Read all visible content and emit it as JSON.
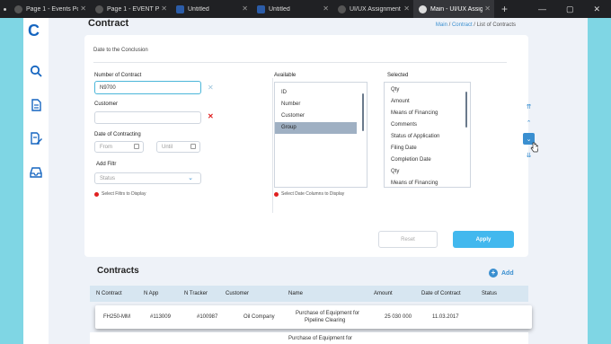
{
  "browser": {
    "tabs": [
      {
        "title": "Page 1 - Events Port"
      },
      {
        "title": "Page 1 - EVENT PAG"
      },
      {
        "title": "Untitled"
      },
      {
        "title": "Untitled"
      },
      {
        "title": "UI/UX Assignment"
      },
      {
        "title": "Main - UI/UX Assig"
      }
    ],
    "new_tab": "+",
    "controls": {
      "min": "—",
      "max": "▢",
      "close": "✕"
    }
  },
  "sidebar": {
    "logo": "C",
    "items": [
      "search-icon",
      "document-icon",
      "edit-document-icon",
      "inbox-icon"
    ]
  },
  "header": {
    "title": "Contract",
    "breadcrumb": {
      "main": "Main",
      "contract": "Contract",
      "current": "List of Contracts",
      "sep": "/"
    }
  },
  "filter": {
    "subtitle": "Date to the Conclusion",
    "number_label": "Number of Contract",
    "number_value": "N9700",
    "customer_label": "Customer",
    "customer_value": "",
    "date_label": "Date of Contracting",
    "from_placeholder": "From",
    "until_placeholder": "Until",
    "add_filter_label": "Add Filtr",
    "status_placeholder": "Status",
    "filter_hint": "Select Filtrs to Display",
    "available_label": "Available",
    "available_items": [
      "ID",
      "Number",
      "Customer",
      "Group"
    ],
    "available_selected_index": 3,
    "selected_label": "Selected",
    "selected_items": [
      "Qty",
      "Amount",
      "Means of Financing",
      "Comments",
      "Status of Application",
      "Filing Date",
      "Completion Date",
      "Qty",
      "Means of Financing"
    ],
    "columns_hint": "Select Date Columns to Display",
    "reset_label": "Reset",
    "apply_label": "Apply"
  },
  "contracts": {
    "title": "Contracts",
    "add_label": "Add",
    "headers": [
      "N  Contract",
      "N  App",
      "N  Tracker",
      "Customer",
      "Name",
      "Amount",
      "Date of Contract",
      "Status"
    ],
    "rows": [
      {
        "contract": "FH250-MM",
        "app": "#113009",
        "tracker": "#100987",
        "customer": "Oil Company",
        "name_line1": "Purchase  of Equipment for",
        "name_line2": "Pipeline Clearing",
        "amount": "25 030 000",
        "date": "11.03.2017",
        "status": ""
      },
      {
        "contract": "",
        "app": "",
        "tracker": "",
        "customer": "",
        "name_line1": "Purchase  of Equipment for",
        "name_line2": "",
        "amount": "",
        "date": "",
        "status": ""
      }
    ]
  },
  "colors": {
    "accent": "#3a8fd0",
    "apply": "#42b8ee",
    "error": "#e02020",
    "frame": "#7fd6e4"
  }
}
